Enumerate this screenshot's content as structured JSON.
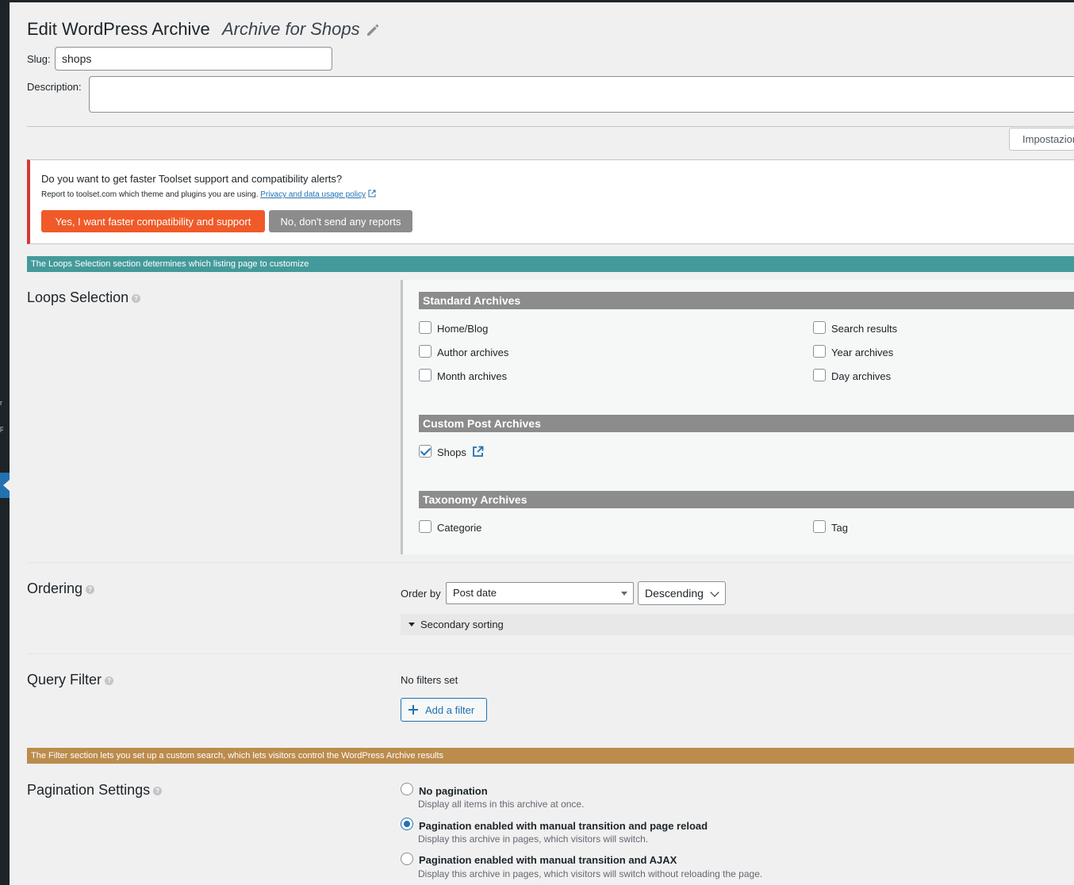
{
  "header": {
    "title": "Edit WordPress Archive",
    "archive_name": "Archive for Shops"
  },
  "slug": {
    "label": "Slug:",
    "value": "shops"
  },
  "description": {
    "label": "Description:",
    "value": ""
  },
  "toolbar": {
    "settings_label": "Impostazioni"
  },
  "notice": {
    "heading": "Do you want to get faster Toolset support and compatibility alerts?",
    "text": "Report to toolset.com which theme and plugins you are using.",
    "link_text": "Privacy and data usage policy",
    "yes_button": "Yes, I want faster compatibility and support",
    "no_button": "No, don't send any reports"
  },
  "bands": {
    "loops": "The Loops Selection section determines which listing page to customize",
    "filter": "The Filter section lets you set up a custom search, which lets visitors control the WordPress Archive results"
  },
  "loops": {
    "title": "Loops Selection",
    "standard": {
      "heading": "Standard Archives",
      "items": [
        {
          "label": "Home/Blog",
          "checked": false
        },
        {
          "label": "Search results",
          "checked": false
        },
        {
          "label": "Author archives",
          "checked": false
        },
        {
          "label": "Year archives",
          "checked": false
        },
        {
          "label": "Month archives",
          "checked": false
        },
        {
          "label": "Day archives",
          "checked": false
        }
      ]
    },
    "custom": {
      "heading": "Custom Post Archives",
      "items": [
        {
          "label": "Shops",
          "checked": true
        }
      ]
    },
    "taxonomy": {
      "heading": "Taxonomy Archives",
      "items": [
        {
          "label": "Categorie",
          "checked": false
        },
        {
          "label": "Tag",
          "checked": false
        }
      ]
    }
  },
  "ordering": {
    "title": "Ordering",
    "order_by_label": "Order by",
    "order_by_value": "Post date",
    "direction_value": "Descending",
    "secondary_label": "Secondary sorting"
  },
  "query_filter": {
    "title": "Query Filter",
    "empty_text": "No filters set",
    "add_button": "Add a filter"
  },
  "pagination": {
    "title": "Pagination Settings",
    "options": [
      {
        "label": "No pagination",
        "description": "Display all items in this archive at once.",
        "selected": false
      },
      {
        "label": "Pagination enabled with manual transition and page reload",
        "description": "Display this archive in pages, which visitors will switch.",
        "selected": true
      },
      {
        "label": "Pagination enabled with manual transition and AJAX",
        "description": "Display this archive in pages, which visitors will switch without reloading the page.",
        "selected": false
      }
    ]
  }
}
